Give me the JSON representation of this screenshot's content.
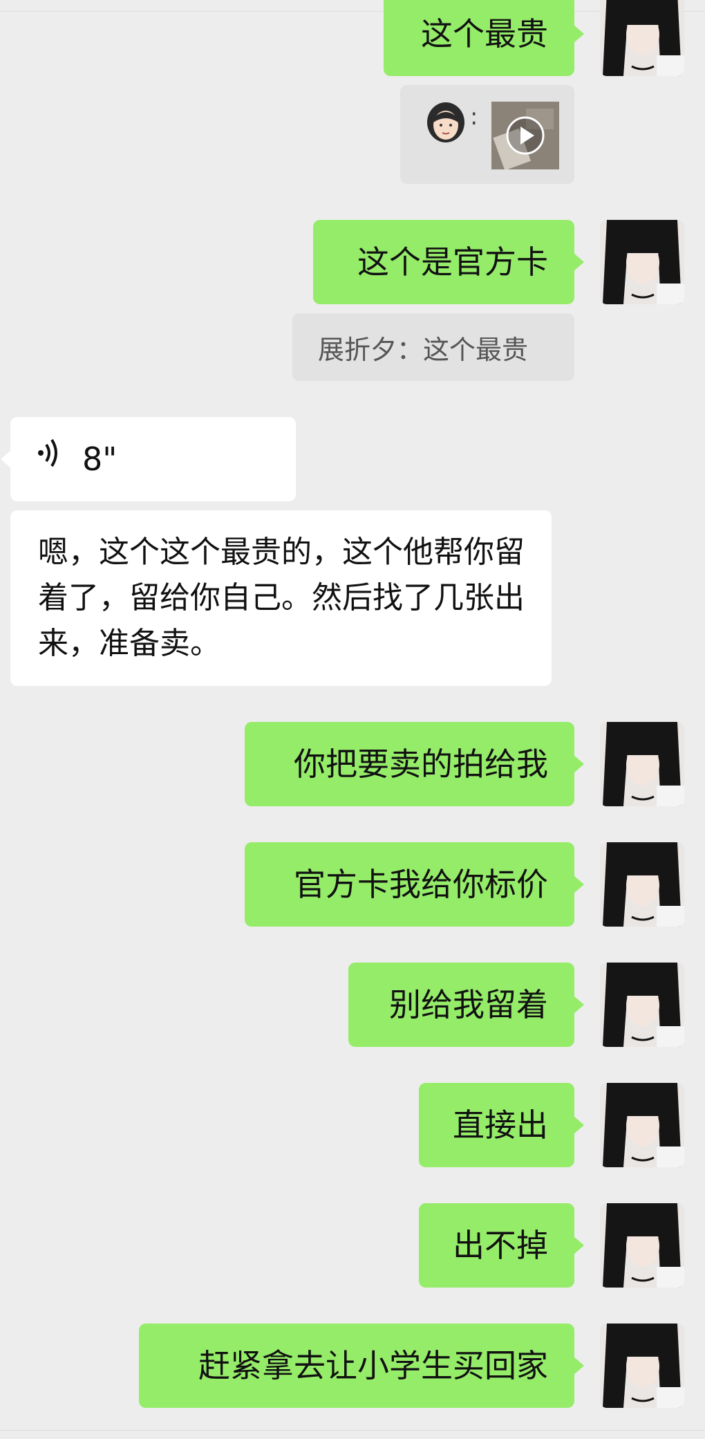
{
  "messages": {
    "m1": "这个最贵",
    "m2": "这个是官方卡",
    "quote_text": "展折夕：这个最贵",
    "voice_duration": "8\"",
    "voice_icon": "))",
    "m3": "嗯，这个这个最贵的，这个他帮你留着了，留给你自己。然后找了几张出来，准备卖。",
    "m4": "你把要卖的拍给我",
    "m5": "官方卡我给你标价",
    "m6": "别给我留着",
    "m7": "直接出",
    "m8": "出不掉",
    "m9": "赶紧拿去让小学生买回家"
  },
  "quote_media": {
    "separator": ":",
    "media_type": "video"
  },
  "colors": {
    "outgoing": "#95ec69",
    "incoming": "#ffffff",
    "background": "#ededed",
    "quote": "#e2e2e2"
  }
}
